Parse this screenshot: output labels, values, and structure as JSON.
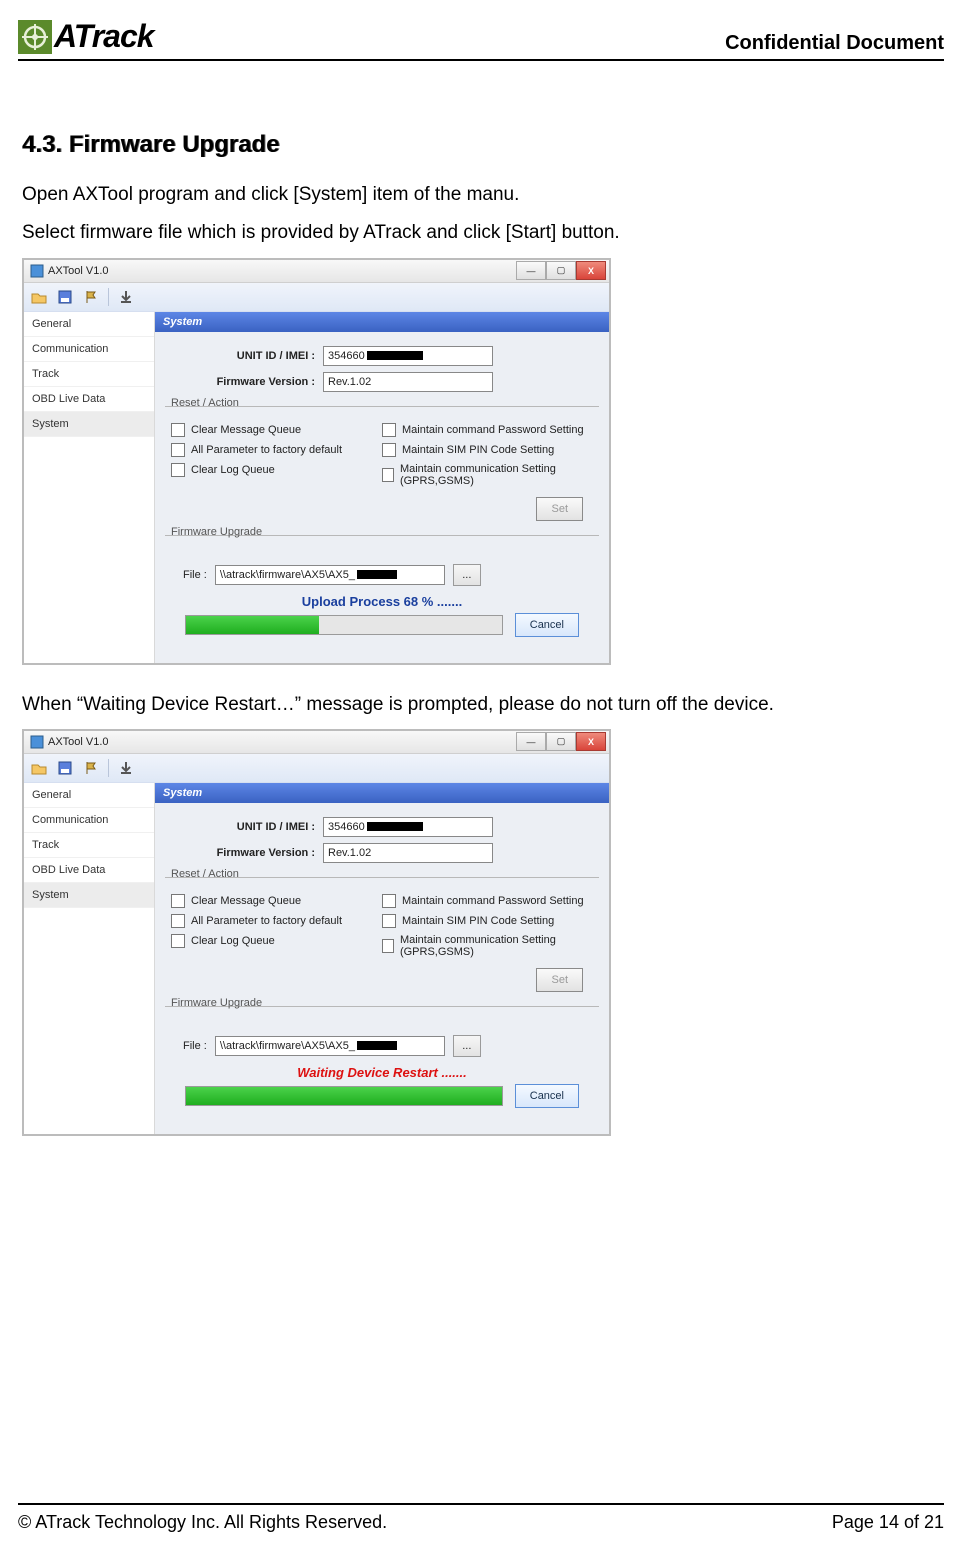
{
  "header": {
    "logo_text": "ATrack",
    "confidential": "Confidential Document"
  },
  "body": {
    "section_title": "4.3. Firmware Upgrade",
    "para1": "Open AXTool program and click [System] item of the manu.",
    "para2": "Select firmware file which is provided by ATrack and click [Start] button.",
    "para3": "When “Waiting Device Restart…” message is prompted, please do not turn off the device."
  },
  "ax": {
    "title": "AXTool V1.0",
    "sidebar": [
      "General",
      "Communication",
      "Track",
      "OBD Live Data",
      "System"
    ],
    "panel_head": "System",
    "field_unit_label": "UNIT ID / IMEI :",
    "field_unit_value": "354660",
    "field_fw_label": "Firmware Version :",
    "field_fw_value": "Rev.1.02",
    "reset_legend": "Reset / Action",
    "chk_cmq": "Clear Message Queue",
    "chk_afd": "All Parameter to factory default",
    "chk_clq": "Clear Log Queue",
    "chk_mcp": "Maintain command Password Setting",
    "chk_msp": "Maintain SIM PIN Code Setting",
    "chk_mcs": "Maintain communication Setting (GPRS,GSMS)",
    "btn_set": "Set",
    "fw_legend": "Firmware Upgrade",
    "file_label": "File :",
    "file_value": "\\\\atrack\\firmware\\AX5\\AX5_",
    "browse": "...",
    "status1": "Upload Process 68 % .......",
    "status2": "Waiting  Device Restart .......",
    "btn_cancel": "Cancel",
    "progress1_pct": 42
  },
  "footer": {
    "copyright": "© ATrack Technology Inc. All Rights Reserved.",
    "page": "Page 14 of 21"
  }
}
